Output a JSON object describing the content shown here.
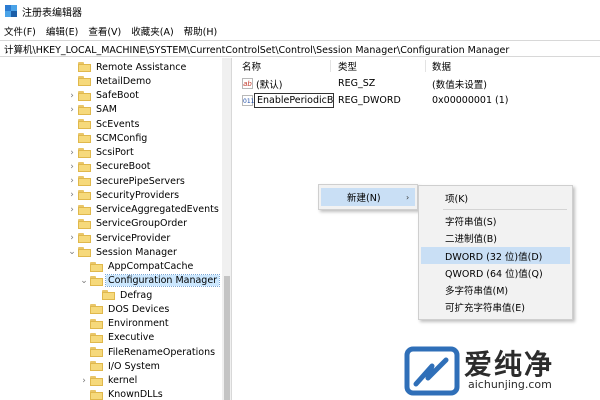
{
  "window": {
    "title": "注册表编辑器"
  },
  "menu": [
    "文件(F)",
    "编辑(E)",
    "查看(V)",
    "收藏夹(A)",
    "帮助(H)"
  ],
  "address": "计算机\\HKEY_LOCAL_MACHINE\\SYSTEM\\CurrentControlSet\\Control\\Session Manager\\Configuration Manager",
  "tree": {
    "items": [
      {
        "label": "Remote Assistance",
        "expander": "",
        "indent": 0
      },
      {
        "label": "RetailDemo",
        "expander": "",
        "indent": 0
      },
      {
        "label": "SafeBoot",
        "expander": "›",
        "indent": 0
      },
      {
        "label": "SAM",
        "expander": "›",
        "indent": 0
      },
      {
        "label": "ScEvents",
        "expander": "",
        "indent": 0
      },
      {
        "label": "SCMConfig",
        "expander": "",
        "indent": 0
      },
      {
        "label": "ScsiPort",
        "expander": "›",
        "indent": 0
      },
      {
        "label": "SecureBoot",
        "expander": "›",
        "indent": 0
      },
      {
        "label": "SecurePipeServers",
        "expander": "›",
        "indent": 0
      },
      {
        "label": "SecurityProviders",
        "expander": "›",
        "indent": 0
      },
      {
        "label": "ServiceAggregatedEvents",
        "expander": "›",
        "indent": 0
      },
      {
        "label": "ServiceGroupOrder",
        "expander": "",
        "indent": 0
      },
      {
        "label": "ServiceProvider",
        "expander": "›",
        "indent": 0
      },
      {
        "label": "Session Manager",
        "expander": "⌄",
        "indent": 0
      },
      {
        "label": "AppCompatCache",
        "expander": "",
        "indent": 1
      },
      {
        "label": "Configuration Manager",
        "expander": "⌄",
        "indent": 1,
        "selected": true
      },
      {
        "label": "Defrag",
        "expander": "",
        "indent": 2
      },
      {
        "label": "DOS Devices",
        "expander": "",
        "indent": 1
      },
      {
        "label": "Environment",
        "expander": "",
        "indent": 1
      },
      {
        "label": "Executive",
        "expander": "",
        "indent": 1
      },
      {
        "label": "FileRenameOperations",
        "expander": "",
        "indent": 1
      },
      {
        "label": "I/O System",
        "expander": "",
        "indent": 1
      },
      {
        "label": "kernel",
        "expander": "›",
        "indent": 1
      },
      {
        "label": "KnownDLLs",
        "expander": "",
        "indent": 1
      }
    ]
  },
  "list": {
    "headers": {
      "name": "名称",
      "type": "类型",
      "data": "数据"
    },
    "rows": [
      {
        "icon": "ab",
        "name": "(默认)",
        "type": "REG_SZ",
        "data": "(数值未设置)"
      },
      {
        "icon": "011",
        "name": "EnablePeriodicB...",
        "type": "REG_DWORD",
        "data": "0x00000001 (1)",
        "editing": true
      }
    ]
  },
  "context_menu": {
    "new_label": "新建(N)",
    "new_arrow": "›",
    "submenu": [
      "项(K)",
      "字符串值(S)",
      "二进制值(B)",
      "DWORD (32 位)值(D)",
      "QWORD (64 位)值(Q)",
      "多字符串值(M)",
      "可扩充字符串值(E)"
    ],
    "highlighted_index": 3
  },
  "watermark": {
    "text": "爱纯净",
    "url": "aichunjing.com"
  },
  "colors": {
    "highlight": "#c9dff5",
    "selection": "#cce8ff",
    "folder": "#f6d97b"
  }
}
